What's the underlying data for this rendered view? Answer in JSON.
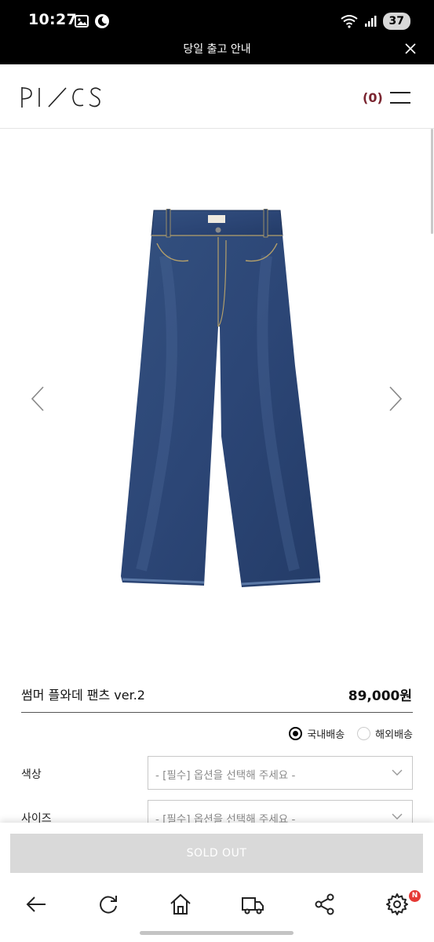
{
  "status_bar": {
    "time": "10:27",
    "battery": "37",
    "icons": [
      "gallery-icon",
      "moon-icon",
      "wifi-icon",
      "signal-icon",
      "battery-icon"
    ]
  },
  "notice": {
    "text": "당일 출고 안내",
    "close_icon": "close-icon"
  },
  "header": {
    "logo": "PI/CS",
    "cart_count": "(0)",
    "menu_icon": "hamburger-icon"
  },
  "gallery": {
    "prev_icon": "chevron-left-icon",
    "next_icon": "chevron-right-icon",
    "image": "denim-wide-pants-image"
  },
  "product": {
    "name": "썸머 플와데 팬츠 ver.2",
    "price": "89,000원"
  },
  "shipping": {
    "options": [
      {
        "label": "국내배송",
        "selected": true
      },
      {
        "label": "해외배송",
        "selected": false
      }
    ]
  },
  "options": [
    {
      "label": "색상",
      "placeholder": "- [필수] 옵션을 선택해 주세요 -"
    },
    {
      "label": "사이즈",
      "placeholder": "- [필수] 옵션을 선택해 주세요 -"
    }
  ],
  "bottom": {
    "soldout_label": "SOLD OUT"
  },
  "nav": {
    "items": [
      "back-icon",
      "refresh-icon",
      "home-icon",
      "delivery-truck-icon",
      "share-icon",
      "settings-icon"
    ],
    "badge": "N"
  },
  "colors": {
    "cart_accent": "#7a2530",
    "soldout_bg": "#d9d9d9",
    "badge": "#e53935"
  }
}
